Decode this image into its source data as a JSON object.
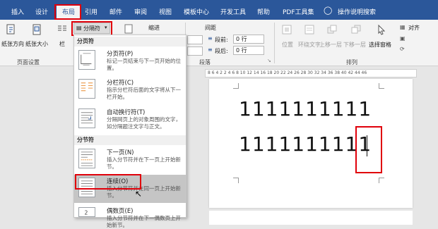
{
  "tabs": [
    {
      "label": "插入"
    },
    {
      "label": "设计"
    },
    {
      "label": "布局"
    },
    {
      "label": "引用"
    },
    {
      "label": "邮件"
    },
    {
      "label": "审阅"
    },
    {
      "label": "视图"
    },
    {
      "label": "模板中心"
    },
    {
      "label": "开发工具"
    },
    {
      "label": "帮助"
    },
    {
      "label": "PDF工具集"
    },
    {
      "label": "操作说明搜索"
    }
  ],
  "ribbon": {
    "text_direction": "纸张方向",
    "paper_size": "纸张大小",
    "columns": "栏",
    "page_setup_group": "页面设置",
    "breaks_button": "分隔符",
    "indent_label": "缩进",
    "spacing_label": "间距",
    "before_label": "段前:",
    "after_label": "段后:",
    "before_value": "0 行",
    "after_value": "0 行",
    "paragraph_group": "段落",
    "position": "位置",
    "wrap_text": "环绕文字",
    "bring_forward": "上移一层",
    "send_backward": "下移一层",
    "selection_pane": "选择窗格",
    "align": "对齐",
    "arrange_group": "排列"
  },
  "ruler_text": "8 6 4 2   2 4 6 8 10 12 14 16 18 20 22 24 26 28 30 32 34 36 38 40 42 44 46",
  "document": {
    "line1": "1111111111",
    "line2": "1111111111"
  },
  "menu": {
    "page_breaks_header": "分页符",
    "section_breaks_header": "分节符",
    "items": [
      {
        "title": "分页符(P)",
        "desc": "标记一页结束与下一页开始的位置。"
      },
      {
        "title": "分栏符(C)",
        "desc": "指示分栏符后面的文字将从下一栏开始。"
      },
      {
        "title": "自动换行符(T)",
        "desc": "分隔网页上的对象周围的文字，如分隔题注文字与正文。"
      },
      {
        "title": "下一页(N)",
        "desc": "插入分节符并在下一页上开始新节。"
      },
      {
        "title": "连续(O)",
        "desc": "插入分节符并在同一页上开始新节。"
      },
      {
        "title": "偶数页(E)",
        "desc": "插入分节符并在下一偶数页上开始新节。"
      }
    ]
  },
  "colors": {
    "accent": "#2b579a",
    "highlight_border": "#e0000a",
    "menu_hover": "#c5c5c5"
  }
}
